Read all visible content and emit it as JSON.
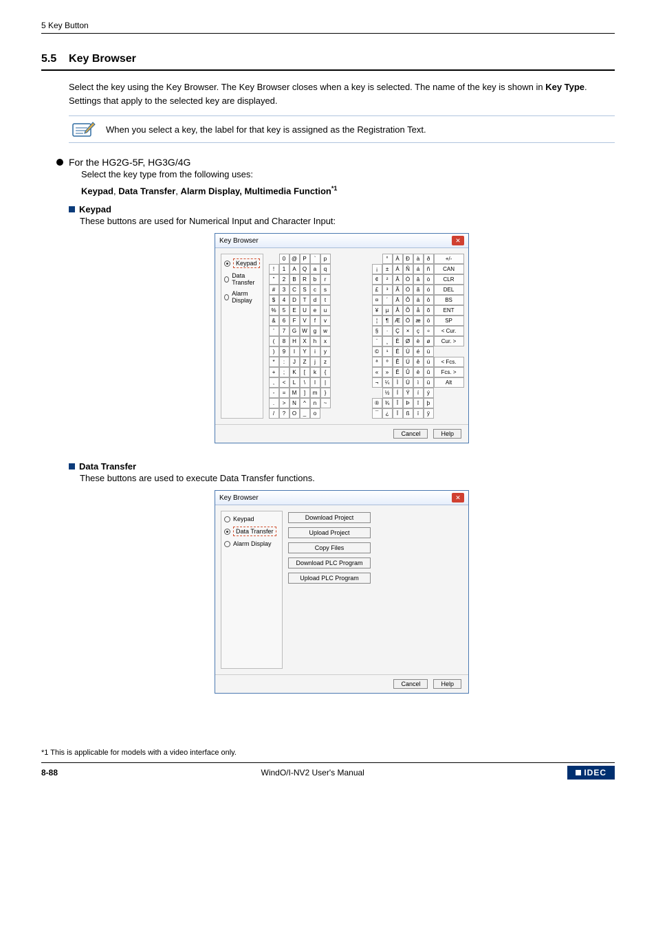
{
  "header": {
    "chapter": "5 Key Button"
  },
  "section": {
    "number": "5.5",
    "title": "Key Browser"
  },
  "intro": "Select the key using the Key Browser. The Key Browser closes when a key is selected. The name of the key is shown in Key Type. Settings that apply to the selected key are displayed.",
  "intro_pre": "Select the key using the Key Browser. The Key Browser closes when a key is selected. The name of the key is shown in ",
  "intro_bold": "Key Type",
  "intro_post": ". Settings that apply to the selected key are displayed.",
  "note": "When you select a key, the label for that key is assigned as the Registration Text.",
  "h1": {
    "title": "For the HG2G-5F, HG3G/4G",
    "sub": "Select the key type from the following uses:"
  },
  "uses_line": {
    "k1": "Keypad",
    "sep1": ", ",
    "k2": "Data Transfer",
    "sep2": ", ",
    "k3": "Alarm Display, Multimedia Function",
    "sup": "*1"
  },
  "keypad_h": "Keypad",
  "keypad_desc": "These buttons are used for Numerical Input and Character Input:",
  "dt_h": "Data Transfer",
  "dt_desc": "These buttons are used to execute Data Transfer functions.",
  "dialog": {
    "title": "Key Browser",
    "radios": {
      "keypad": "Keypad",
      "data_transfer": "Data Transfer",
      "alarm": "Alarm Display"
    },
    "foot": {
      "cancel": "Cancel",
      "help": "Help"
    }
  },
  "kb": {
    "rows": [
      [
        "",
        "0",
        "@",
        "P",
        "`",
        "p",
        "",
        "",
        "",
        "°",
        "À",
        "Ð",
        "à",
        "ð",
        "+/-"
      ],
      [
        "!",
        "1",
        "A",
        "Q",
        "a",
        "q",
        "",
        "",
        "¡",
        "±",
        "Á",
        "Ñ",
        "á",
        "ñ",
        "CAN"
      ],
      [
        "\"",
        "2",
        "B",
        "R",
        "b",
        "r",
        "",
        "",
        "¢",
        "²",
        "Â",
        "Ò",
        "â",
        "ò",
        "CLR"
      ],
      [
        "#",
        "3",
        "C",
        "S",
        "c",
        "s",
        "",
        "",
        "£",
        "³",
        "Ã",
        "Ó",
        "ã",
        "ó",
        "DEL"
      ],
      [
        "$",
        "4",
        "D",
        "T",
        "d",
        "t",
        "",
        "",
        "¤",
        "´",
        "Ä",
        "Ô",
        "ä",
        "ô",
        "BS"
      ],
      [
        "%",
        "5",
        "E",
        "U",
        "e",
        "u",
        "",
        "",
        "¥",
        "µ",
        "Å",
        "Õ",
        "å",
        "õ",
        "ENT"
      ],
      [
        "&",
        "6",
        "F",
        "V",
        "f",
        "v",
        "",
        "",
        "¦",
        "¶",
        "Æ",
        "Ö",
        "æ",
        "ö",
        "SP"
      ],
      [
        "'",
        "7",
        "G",
        "W",
        "g",
        "w",
        "",
        "",
        "§",
        "·",
        "Ç",
        "×",
        "ç",
        "÷",
        "< Cur."
      ],
      [
        "(",
        "8",
        "H",
        "X",
        "h",
        "x",
        "",
        "",
        "¨",
        "¸",
        "È",
        "Ø",
        "è",
        "ø",
        "Cur. >"
      ],
      [
        ")",
        "9",
        "I",
        "Y",
        "i",
        "y",
        "",
        "",
        "©",
        "¹",
        "É",
        "Ù",
        "é",
        "ù",
        ""
      ],
      [
        "*",
        ":",
        "J",
        "Z",
        "j",
        "z",
        "",
        "",
        "ª",
        "º",
        "Ê",
        "Ú",
        "ê",
        "ú",
        "< Fcs."
      ],
      [
        "+",
        ";",
        "K",
        "[",
        "k",
        "{",
        "",
        "",
        "«",
        "»",
        "Ë",
        "Û",
        "ë",
        "û",
        "Fcs. >"
      ],
      [
        ",",
        "<",
        "L",
        "\\",
        "l",
        "|",
        "",
        "",
        "¬",
        "¼",
        "Ì",
        "Ü",
        "ì",
        "ü",
        "Alt"
      ],
      [
        "-",
        "=",
        "M",
        "]",
        "m",
        "}",
        "",
        "",
        "",
        "½",
        "Í",
        "Ý",
        "í",
        "ý",
        ""
      ],
      [
        ".",
        ">",
        "N",
        "^",
        "n",
        "~",
        "",
        "",
        "®",
        "¾",
        "Î",
        "Þ",
        "î",
        "þ",
        ""
      ],
      [
        "/",
        "?",
        "O",
        "_",
        "o",
        "",
        "",
        "",
        "¯",
        "¿",
        "Ï",
        "ß",
        "ï",
        "ÿ",
        ""
      ]
    ]
  },
  "dt_buttons": [
    "Download Project",
    "Upload Project",
    "Copy Files",
    "Download PLC Program",
    "Upload PLC Program"
  ],
  "footnote": "*1  This is applicable for models with a video interface only.",
  "footer": {
    "page": "8-88",
    "manual": "WindO/I-NV2 User's Manual",
    "brand": "IDEC"
  }
}
